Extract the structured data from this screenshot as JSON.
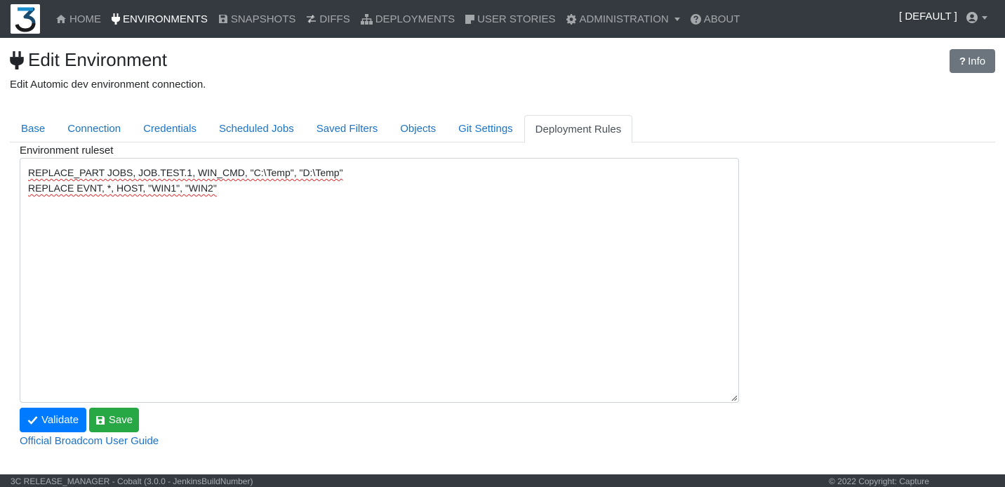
{
  "navbar": {
    "items": [
      {
        "label": "HOME",
        "icon": "home-icon"
      },
      {
        "label": "ENVIRONMENTS",
        "icon": "plug-icon",
        "active": true
      },
      {
        "label": "SNAPSHOTS",
        "icon": "floppy-icon"
      },
      {
        "label": "DIFFS",
        "icon": "exchange-icon"
      },
      {
        "label": "DEPLOYMENTS",
        "icon": "sitemap-icon"
      },
      {
        "label": "USER STORIES",
        "icon": "sticky-note-icon"
      },
      {
        "label": "ADMINISTRATION",
        "icon": "gear-icon",
        "dropdown": true
      },
      {
        "label": "ABOUT",
        "icon": "question-circle-icon"
      }
    ],
    "environment_selector": "[ DEFAULT ]",
    "user_icon": "user-circle-icon"
  },
  "header": {
    "title": "Edit Environment",
    "title_icon": "plug-icon",
    "subtitle": "Edit Automic dev environment connection.",
    "info_label": "Info"
  },
  "tabs": [
    {
      "label": "Base"
    },
    {
      "label": "Connection"
    },
    {
      "label": "Credentials"
    },
    {
      "label": "Scheduled Jobs"
    },
    {
      "label": "Saved Filters"
    },
    {
      "label": "Objects"
    },
    {
      "label": "Git Settings"
    },
    {
      "label": "Deployment Rules",
      "active": true
    }
  ],
  "form": {
    "ruleset_label": "Environment ruleset",
    "ruleset_lines": [
      "REPLACE_PART JOBS, JOB.TEST.1, WIN_CMD, \"C:\\Temp\", \"D:\\Temp\"",
      "REPLACE EVNT, *, HOST, \"WIN1\", \"WIN2\""
    ],
    "validate_label": "Validate",
    "save_label": "Save",
    "guide_link": "Official Broadcom User Guide"
  },
  "footer": {
    "left": "3C RELEASE_MANAGER - Cobalt (3.0.0 - JenkinsBuildNumber)",
    "right": "© 2022 Copyright: Capture"
  },
  "colors": {
    "navbar_bg": "#343a40",
    "primary": "#007bff",
    "success": "#28a745",
    "secondary": "#6c757d",
    "link": "#1a73c8"
  }
}
